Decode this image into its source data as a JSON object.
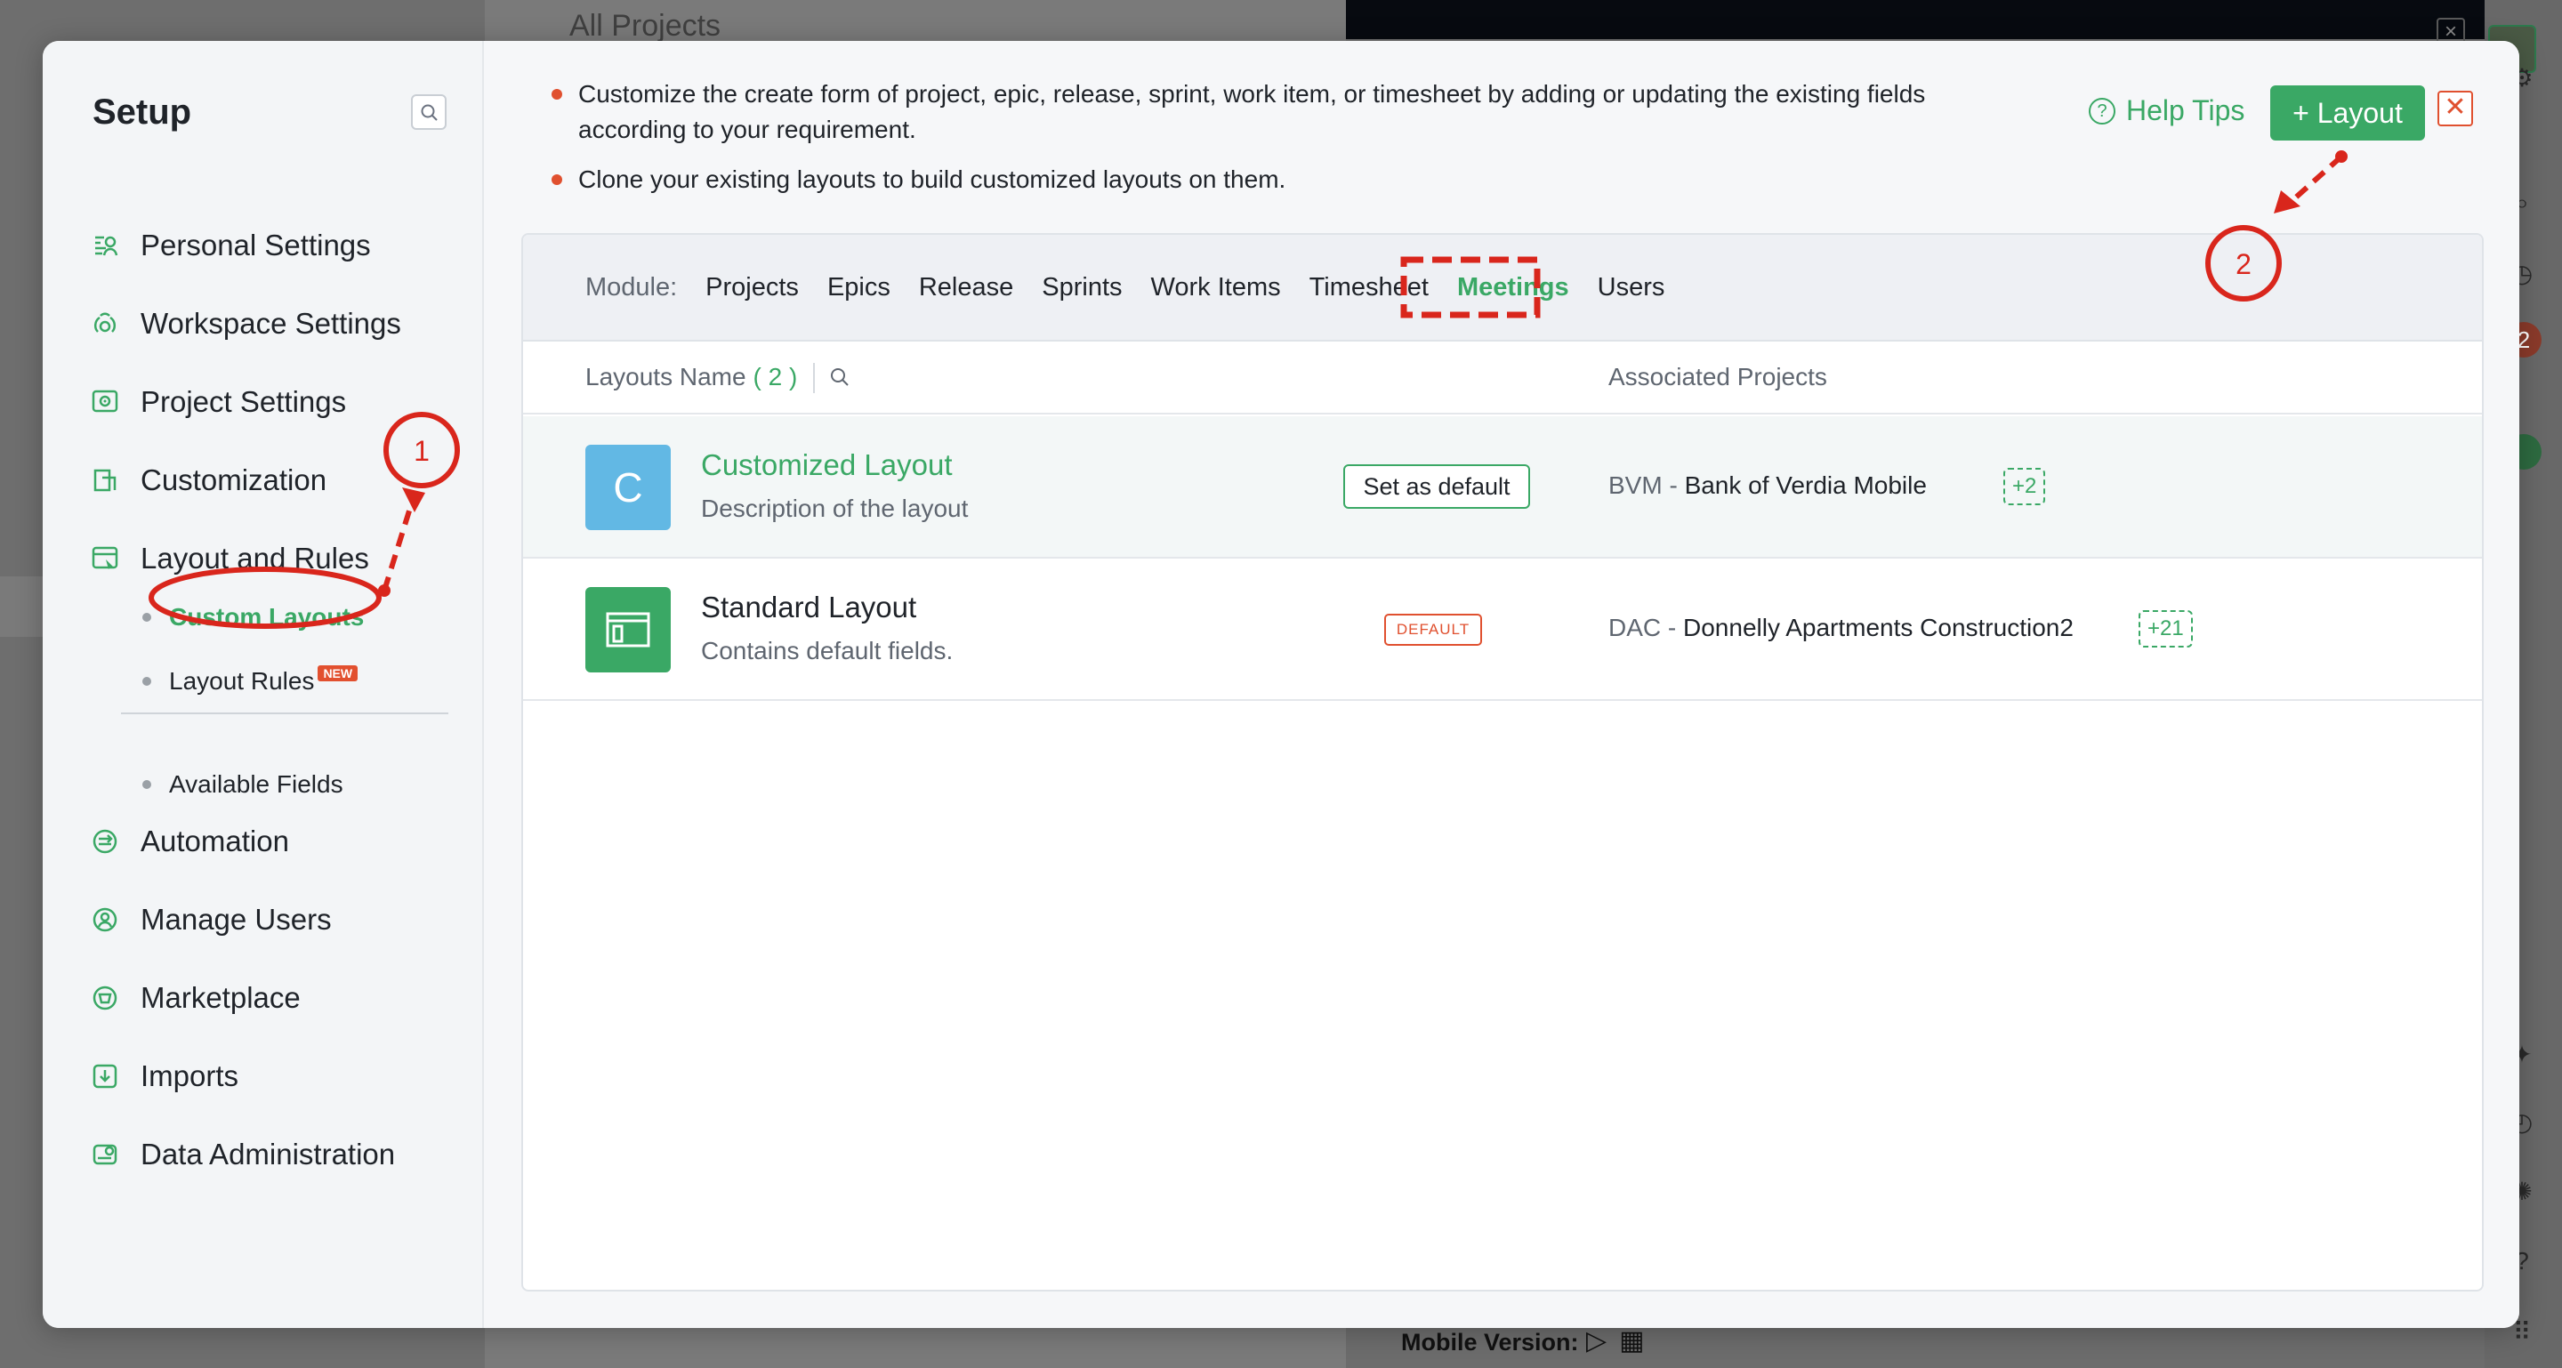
{
  "background": {
    "page_title": "All Projects",
    "footer_label": "Mobile Version:",
    "footer_icons": [
      "apple-icon",
      "play-store-icon",
      "qr-code-icon"
    ]
  },
  "sidebar": {
    "title": "Setup",
    "items": [
      {
        "label": "Personal Settings",
        "icon": "personal-settings-icon"
      },
      {
        "label": "Workspace Settings",
        "icon": "workspace-icon"
      },
      {
        "label": "Project Settings",
        "icon": "project-settings-icon"
      },
      {
        "label": "Customization",
        "icon": "customization-icon"
      },
      {
        "label": "Layout and Rules",
        "icon": "layout-rules-icon"
      },
      {
        "label": "Automation",
        "icon": "automation-icon"
      },
      {
        "label": "Manage Users",
        "icon": "manage-users-icon"
      },
      {
        "label": "Marketplace",
        "icon": "marketplace-icon"
      },
      {
        "label": "Imports",
        "icon": "imports-icon"
      },
      {
        "label": "Data Administration",
        "icon": "data-admin-icon"
      }
    ],
    "sub_items": [
      {
        "label": "Custom Layouts",
        "active": true
      },
      {
        "label": "Layout Rules",
        "badge": "NEW"
      },
      {
        "label": "Available Fields"
      }
    ]
  },
  "content": {
    "tips": [
      "Customize the create form of project, epic, release, sprint, work item, or timesheet by adding or updating the existing fields according to your requirement.",
      "Clone your existing layouts to build customized layouts on them."
    ],
    "help_label": "Help Tips",
    "add_layout_label": "+ Layout",
    "close_label": "✕",
    "module_label": "Module:",
    "tabs": [
      "Projects",
      "Epics",
      "Release",
      "Sprints",
      "Work Items",
      "Timesheet",
      "Meetings",
      "Users"
    ],
    "active_tab": "Meetings",
    "table": {
      "col_name": "Layouts Name",
      "count": "( 2 )",
      "col_projects": "Associated Projects",
      "rows": [
        {
          "avatar_letter": "C",
          "avatar_color": "#62b8e4",
          "name": "Customized Layout",
          "description": "Description of the layout",
          "action_label": "Set as default",
          "project_code": "BVM -",
          "project_name": "Bank of Verdia Mobile",
          "more": "+2"
        },
        {
          "avatar_color": "#3aa865",
          "name": "Standard Layout",
          "description": "Contains default fields.",
          "tag": "DEFAULT",
          "project_code": "DAC -",
          "project_name": "Donnelly Apartments Construction2",
          "more": "+21"
        }
      ]
    }
  },
  "annotations": {
    "marker_1": "1",
    "marker_2": "2",
    "color": "#d9261c"
  }
}
